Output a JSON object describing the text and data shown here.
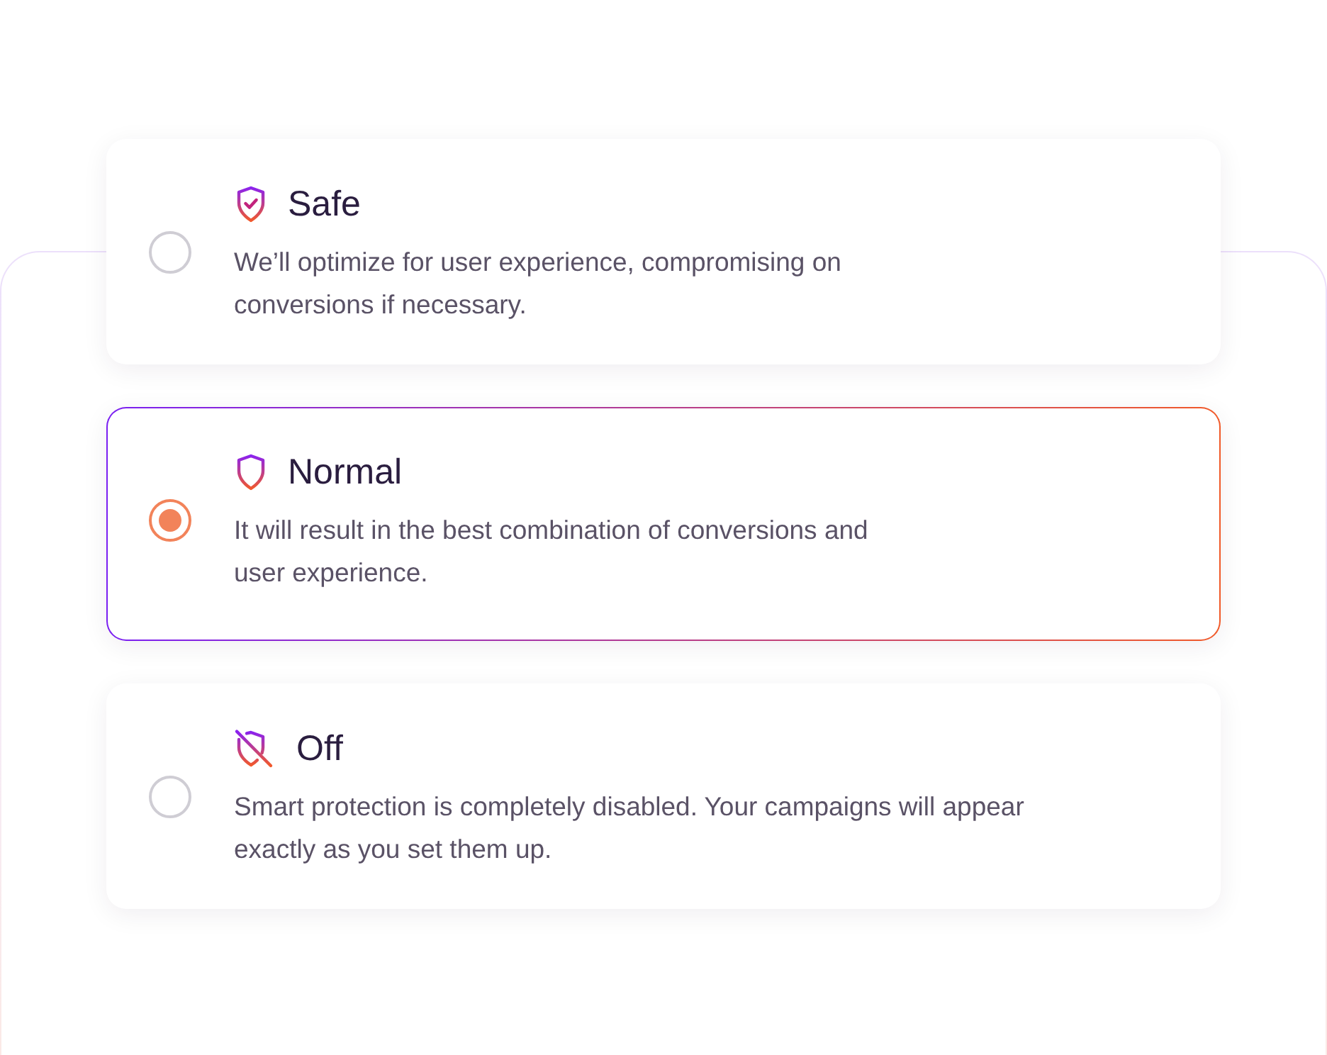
{
  "options": [
    {
      "kind": "check",
      "title": "Safe",
      "description": "We’ll optimize for user experience, compromising on\nconversions if necessary.",
      "selected": false
    },
    {
      "kind": "plain",
      "title": "Normal",
      "description": "It will result in the best combination of conversions and\nuser experience.",
      "selected": true
    },
    {
      "kind": "crossed",
      "title": "Off",
      "description": "Smart protection is completely disabled. Your campaigns will appear\nexactly as you set them up.",
      "selected": false
    }
  ]
}
